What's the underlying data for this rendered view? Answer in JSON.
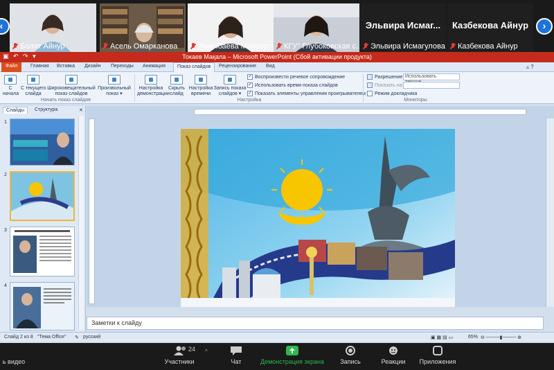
{
  "gallery": {
    "participants": [
      {
        "name": "Болат Айнур",
        "muted": true,
        "video": true
      },
      {
        "name": "Асель Омарканова",
        "muted": true,
        "video": true
      },
      {
        "name": "Жиенбаева Меруерт...",
        "muted": true,
        "video": true
      },
      {
        "name": "КГУ\" Глубоковская с...",
        "muted": true,
        "video": true
      },
      {
        "name": "Эльвира Исмагулова",
        "display_name": "Эльвира  Исмаг...",
        "muted": true,
        "video": false
      },
      {
        "name": "Казбекова Айнур",
        "display_name": "Казбекова Айнур",
        "muted": true,
        "video": false
      }
    ],
    "prev_icon": "chevron-left-icon",
    "next_icon": "chevron-right-icon"
  },
  "ppt": {
    "title": "Токаев Мақала  –  Microsoft PowerPoint (Сбой активации продукта)",
    "quick_access": "▣ ↶ ↷ ▾",
    "tabs": [
      "Файл",
      "Главная",
      "Вставка",
      "Дизайн",
      "Переходы",
      "Анимация",
      "Показ слайдов",
      "Рецензирование",
      "Вид"
    ],
    "active_tab": "Показ слайдов",
    "ribbon": {
      "buttons": [
        {
          "label": "С\nначала"
        },
        {
          "label": "С текущего\nслайда"
        },
        {
          "label": "Широковещательный\nпоказ слайдов"
        },
        {
          "label": "Произвольный\nпоказ ▾"
        },
        {
          "label": "Настройка\nдемонстрации"
        },
        {
          "label": "Скрыть\nслайд"
        },
        {
          "label": "Настройка\nвремени"
        },
        {
          "label": "Запись показа\nслайдов ▾"
        }
      ],
      "group_start": "Начать показ слайдов",
      "group_settings": "Настройка",
      "group_monitors": "Мониторы",
      "checks": [
        {
          "label": "Воспроизвести речевое сопровождение",
          "checked": true
        },
        {
          "label": "Использовать время показа слайдов",
          "checked": true
        },
        {
          "label": "Показать элементы управления проигрывателем",
          "checked": true
        }
      ],
      "resolution_label": "Разрешение:",
      "resolution_value": "Использовать текуще...",
      "show_on_label": "Показать на:",
      "presenter_view": "Режим докладчика"
    },
    "panel_tabs": [
      "Слайды",
      "Структура"
    ],
    "slide_numbers": [
      "1",
      "2",
      "3",
      "4"
    ],
    "notes_placeholder": "Заметки к слайду",
    "status": {
      "slide": "Слайд 2 из 8",
      "theme": "\"Тема Office\"",
      "language": "русский",
      "zoom": "65%"
    }
  },
  "toolbar": {
    "items": [
      {
        "label": "ь видео",
        "icon": "camera-icon"
      },
      {
        "label": "Участники",
        "icon": "participants-icon",
        "count": "24"
      },
      {
        "label": "Чат",
        "icon": "chat-icon"
      },
      {
        "label": "Демонстрация экрана",
        "icon": "share-screen-icon"
      },
      {
        "label": "Запись",
        "icon": "record-icon"
      },
      {
        "label": "Реакции",
        "icon": "reactions-icon"
      },
      {
        "label": "Приложения",
        "icon": "apps-icon"
      }
    ],
    "colors": {
      "share": "#2db84d",
      "bg": "#1a1a1a"
    }
  }
}
